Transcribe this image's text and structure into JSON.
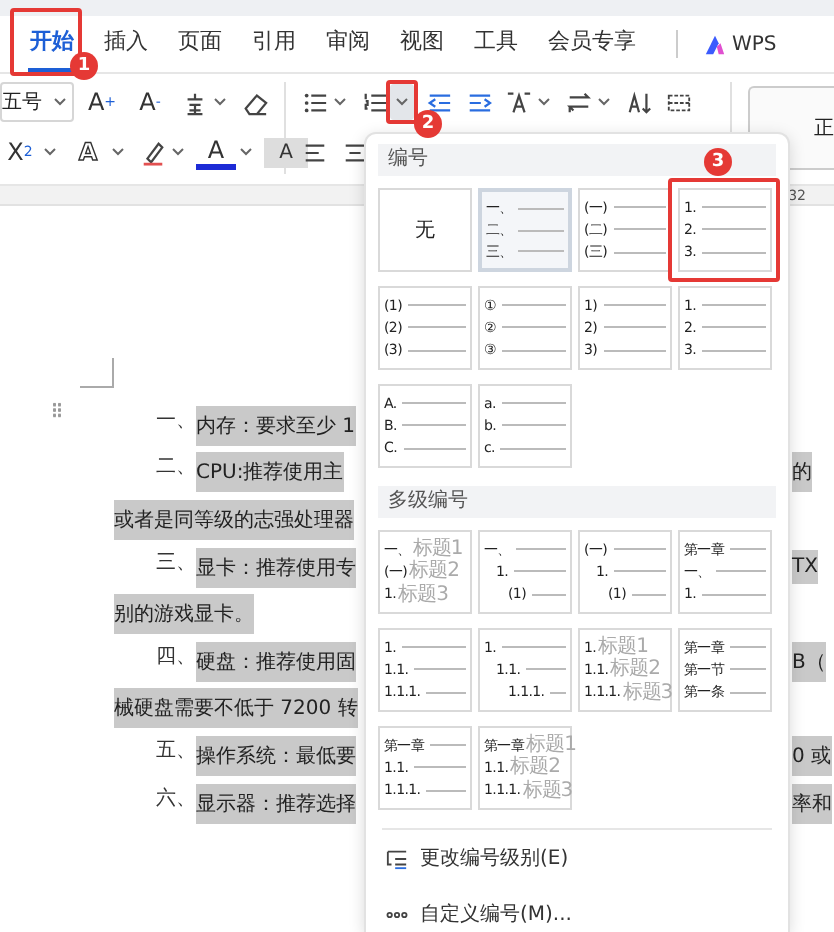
{
  "tabs": [
    {
      "label": "开始",
      "selected": true,
      "callout": "1"
    },
    {
      "label": "插入",
      "selected": false
    },
    {
      "label": "页面",
      "selected": false
    },
    {
      "label": "引用",
      "selected": false
    },
    {
      "label": "审阅",
      "selected": false
    },
    {
      "label": "视图",
      "selected": false
    },
    {
      "label": "工具",
      "selected": false
    },
    {
      "label": "会员专享",
      "selected": false
    }
  ],
  "ai_tab": {
    "label": "WPS"
  },
  "ribbon": {
    "font_rows": [
      [
        {
          "kind": "dropdown",
          "text": "五号"
        },
        {
          "kind": "glyph",
          "text": "A$^{+}$"
        },
        {
          "kind": "glyph",
          "text": "A$^{-}$"
        },
        {
          "kind": "pinyin",
          "caret": true
        },
        {
          "kind": "eraser"
        }
      ],
      [
        {
          "kind": "glyph",
          "text": "X$^{2}$",
          "caret": true
        },
        {
          "kind": "outline-glyph",
          "text": "A",
          "caret": true
        },
        {
          "kind": "highlighter",
          "caret": true
        },
        {
          "kind": "color-glyph",
          "text": "A",
          "caret": true
        },
        {
          "kind": "shaded-glyph",
          "text": "A"
        }
      ]
    ],
    "para_rows": [
      [
        {
          "kind": "bullets",
          "caret": true
        },
        {
          "kind": "numbering",
          "caret": true,
          "pressed": true,
          "callout": "2"
        },
        {
          "kind": "outdent"
        },
        {
          "kind": "indent"
        },
        {
          "kind": "text-direction",
          "caret": true
        },
        {
          "kind": "swap",
          "caret": true
        },
        {
          "kind": "sort"
        },
        {
          "kind": "grid"
        }
      ],
      [
        {
          "kind": "align-left"
        },
        {
          "kind": "align-center"
        }
      ]
    ],
    "style_box": {
      "text": "正"
    }
  },
  "ruler": {
    "number": "32"
  },
  "document": {
    "lines": [
      {
        "kind": "first",
        "lead": "一、",
        "text": "内存：要求至少 1",
        "highlighted": true
      },
      {
        "kind": "first",
        "lead": "二、",
        "text": "CPU:推荐使用主",
        "right": "的",
        "highlighted": true
      },
      {
        "kind": "cont",
        "text": "或者是同等级的志强处理器",
        "highlighted": true
      },
      {
        "kind": "first",
        "lead": "三、",
        "text": "显卡：推荐使用专",
        "right": "TX",
        "highlighted": true
      },
      {
        "kind": "cont",
        "text": "别的游戏显卡。",
        "highlighted": true
      },
      {
        "kind": "first",
        "lead": "四、",
        "text": "硬盘：推荐使用固",
        "right": "B（",
        "highlighted": true
      },
      {
        "kind": "cont",
        "text": "械硬盘需要不低于 7200 转",
        "highlighted": true
      },
      {
        "kind": "first",
        "lead": "五、",
        "text": "操作系统：最低要",
        "right": "0 或",
        "highlighted": true
      },
      {
        "kind": "first",
        "lead": "六、",
        "text": "显示器：推荐选择",
        "right": "率和",
        "highlighted": true
      }
    ]
  },
  "numbering_menu": {
    "sections": [
      {
        "title": "编号",
        "cells": [
          {
            "kind": "none",
            "label": "无",
            "selected": false
          },
          {
            "kind": "flat",
            "selected": true,
            "lines": [
              {
                "num": "一、"
              },
              {
                "num": "二、"
              },
              {
                "num": "三、"
              }
            ]
          },
          {
            "kind": "flat",
            "selected": false,
            "lines": [
              {
                "num": "(一)"
              },
              {
                "num": "(二)"
              },
              {
                "num": "(三)"
              }
            ]
          },
          {
            "kind": "flat",
            "selected": false,
            "callout": "3",
            "lines": [
              {
                "num": "1."
              },
              {
                "num": "2."
              },
              {
                "num": "3."
              }
            ]
          },
          {
            "kind": "flat",
            "selected": false,
            "lines": [
              {
                "num": "(1)"
              },
              {
                "num": "(2)"
              },
              {
                "num": "(3)"
              }
            ]
          },
          {
            "kind": "flat",
            "selected": false,
            "lines": [
              {
                "num": "①"
              },
              {
                "num": "②"
              },
              {
                "num": "③"
              }
            ]
          },
          {
            "kind": "flat",
            "selected": false,
            "lines": [
              {
                "num": "1)"
              },
              {
                "num": "2)"
              },
              {
                "num": "3)"
              }
            ]
          },
          {
            "kind": "flat",
            "selected": false,
            "lines": [
              {
                "num": "1."
              },
              {
                "num": "2."
              },
              {
                "num": "3."
              }
            ]
          },
          {
            "kind": "flat",
            "selected": false,
            "lines": [
              {
                "num": "A."
              },
              {
                "num": "B."
              },
              {
                "num": "C."
              }
            ]
          },
          {
            "kind": "flat",
            "selected": false,
            "lines": [
              {
                "num": "a."
              },
              {
                "num": "b."
              },
              {
                "num": "c."
              }
            ]
          }
        ]
      },
      {
        "title": "多级编号",
        "cells": [
          {
            "kind": "flat",
            "selected": false,
            "lines": [
              {
                "num": "一、",
                "text": "标题1"
              },
              {
                "num": "(一)",
                "text": "标题2"
              },
              {
                "num": "1.",
                "text": "标题3"
              }
            ]
          },
          {
            "kind": "stepped",
            "selected": false,
            "lines": [
              {
                "num": "一、"
              },
              {
                "num": "1."
              },
              {
                "num": "(1)"
              }
            ]
          },
          {
            "kind": "stepped",
            "selected": false,
            "lines": [
              {
                "num": "(一)"
              },
              {
                "num": "1."
              },
              {
                "num": "(1)"
              }
            ]
          },
          {
            "kind": "flat",
            "selected": false,
            "lines": [
              {
                "num": "第一章"
              },
              {
                "num": "一、"
              },
              {
                "num": "1."
              }
            ]
          },
          {
            "kind": "flat",
            "selected": false,
            "lines": [
              {
                "num": "1."
              },
              {
                "num": "1.1."
              },
              {
                "num": "1.1.1."
              }
            ]
          },
          {
            "kind": "stepped",
            "selected": false,
            "lines": [
              {
                "num": "1."
              },
              {
                "num": "1.1."
              },
              {
                "num": "1.1.1."
              }
            ]
          },
          {
            "kind": "flat",
            "selected": false,
            "lines": [
              {
                "num": "1.",
                "text": "标题1"
              },
              {
                "num": "1.1.",
                "text": "标题2"
              },
              {
                "num": "1.1.1.",
                "text": "标题3"
              }
            ]
          },
          {
            "kind": "flat",
            "selected": false,
            "lines": [
              {
                "num": "第一章"
              },
              {
                "num": "第一节"
              },
              {
                "num": "第一条"
              }
            ]
          },
          {
            "kind": "flat",
            "selected": false,
            "lines": [
              {
                "num": "第一章"
              },
              {
                "num": "1.1."
              },
              {
                "num": "1.1.1."
              }
            ]
          },
          {
            "kind": "flat",
            "selected": false,
            "lines": [
              {
                "num": "第一章",
                "text": "标题1"
              },
              {
                "num": "1.1.",
                "text": "标题2"
              },
              {
                "num": "1.1.1.",
                "text": "标题3"
              }
            ]
          }
        ]
      }
    ],
    "actions": [
      {
        "kind": "levels",
        "label": "更改编号级别(E)"
      },
      {
        "kind": "custom",
        "label": "自定义编号(M)..."
      }
    ]
  }
}
